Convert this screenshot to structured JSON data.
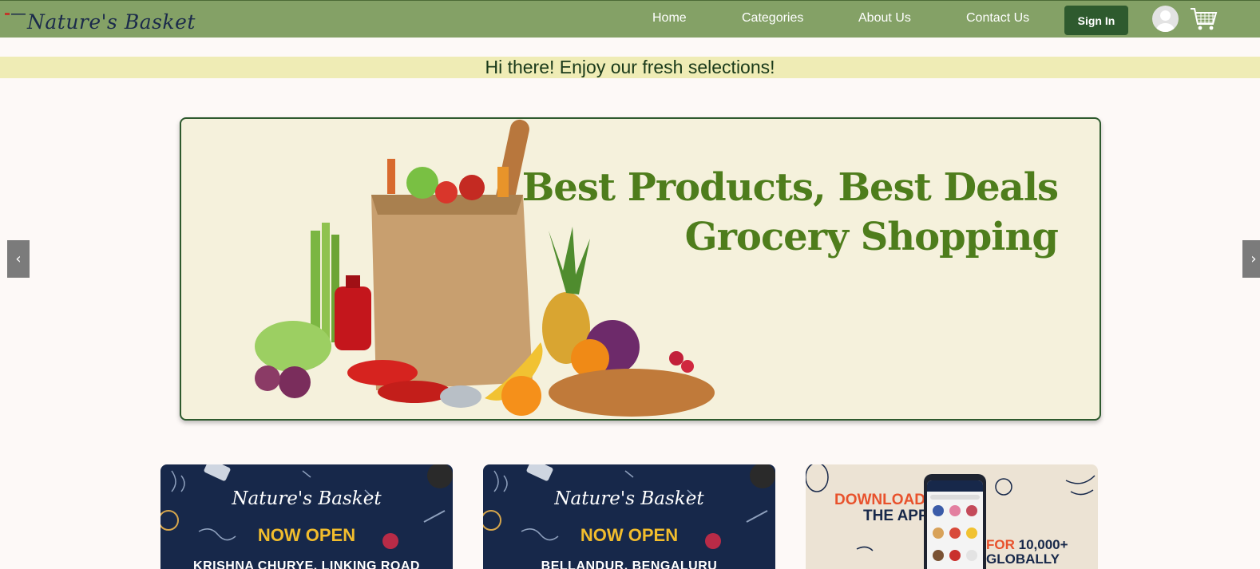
{
  "nav": {
    "logo_text": "Nature's Basket",
    "links": [
      "Home",
      "Categories",
      "About Us",
      "Contact Us"
    ],
    "signin_label": "Sign In"
  },
  "greeting": "Hi there! Enjoy our fresh selections!",
  "carousel": {
    "prev_label": "‹",
    "next_label": "›",
    "slide_title_line1": "Best Products, Best Deals",
    "slide_title_line2": "Grocery Shopping"
  },
  "cards": [
    {
      "brand": "Nature's Basket",
      "status": "NOW OPEN",
      "location": "KRISHNA CHURYE, LINKING ROAD"
    },
    {
      "brand": "Nature's Basket",
      "status": "NOW OPEN",
      "location": "BELLANDUR, BENGALURU"
    },
    {
      "line1": "DOWNLOAD",
      "line2": "THE APP",
      "line3_prefix": "FOR",
      "line3_rest": "10,000+",
      "line4": "GLOBALLY"
    }
  ],
  "colors": {
    "navbar": "#84a166",
    "accent_dark": "#2e5a2e",
    "greeting_bg": "#efecb5",
    "slide_bg": "#f5f1dc",
    "slide_title": "#4e7d1c",
    "card_dark": "#17284a",
    "card_gold": "#f2bd2d",
    "card_orange": "#e8522c"
  },
  "icons": [
    "user-avatar-icon",
    "shopping-cart-icon",
    "chevron-left-icon",
    "chevron-right-icon"
  ]
}
